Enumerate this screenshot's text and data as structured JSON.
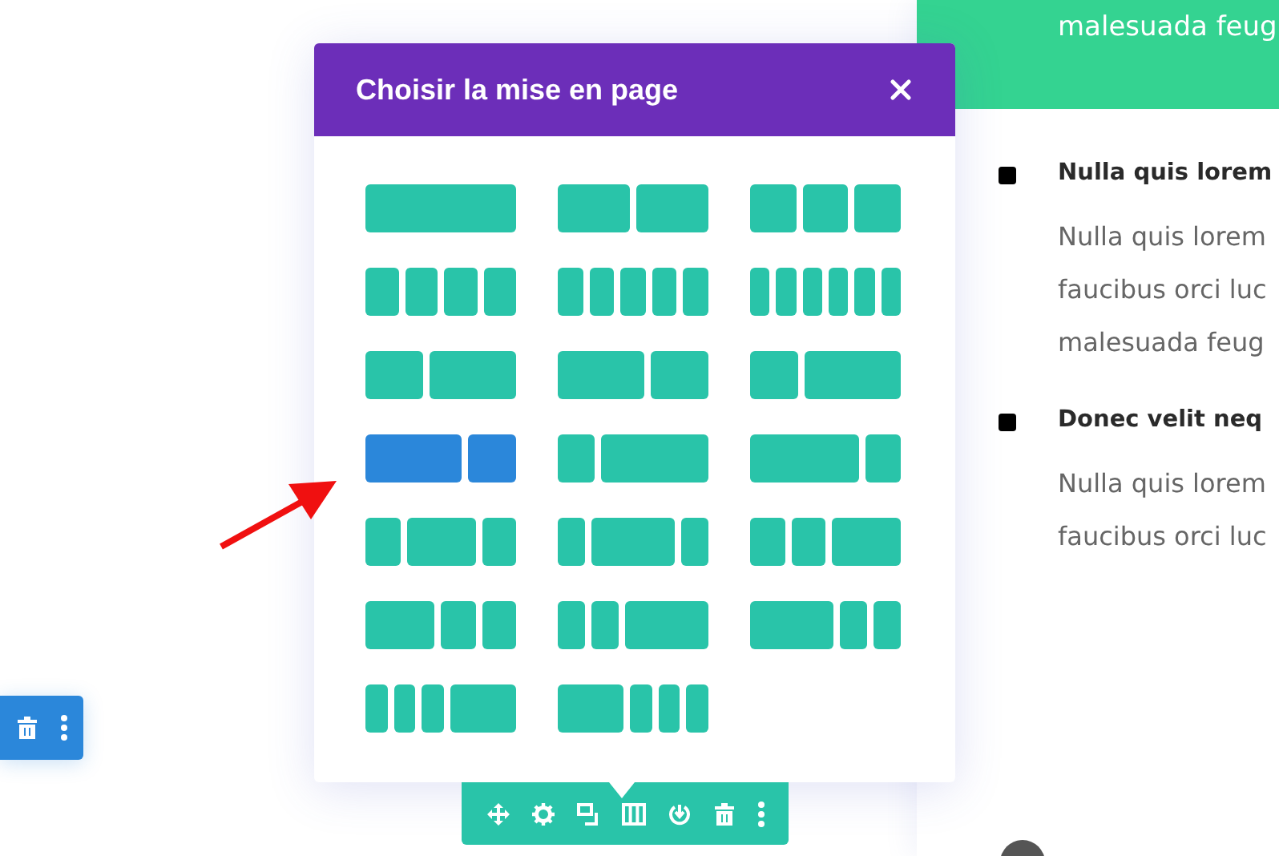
{
  "content": {
    "banner_text": "malesuada feug",
    "items": [
      {
        "heading": "Nulla quis lorem",
        "lines": [
          "Nulla quis lorem",
          "faucibus orci luc",
          "malesuada feug"
        ]
      },
      {
        "heading": "Donec velit neq",
        "lines": [
          "Nulla quis lorem",
          "faucibus orci luc"
        ]
      }
    ]
  },
  "modal": {
    "title": "Choisir la mise en page",
    "layouts": [
      {
        "selected": false
      },
      {
        "selected": false
      },
      {
        "selected": false
      },
      {
        "selected": false
      },
      {
        "selected": false
      },
      {
        "selected": false
      },
      {
        "selected": false
      },
      {
        "selected": false
      },
      {
        "selected": false
      },
      {
        "selected": true
      },
      {
        "selected": false
      },
      {
        "selected": false
      },
      {
        "selected": false
      },
      {
        "selected": false
      },
      {
        "selected": false
      },
      {
        "selected": false
      },
      {
        "selected": false
      },
      {
        "selected": false
      },
      {
        "selected": false
      },
      {
        "selected": false
      }
    ]
  }
}
